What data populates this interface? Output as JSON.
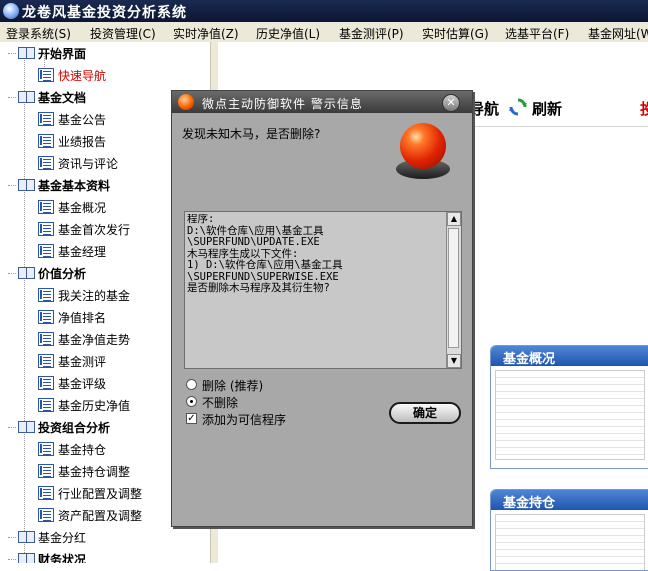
{
  "window": {
    "title": "龙卷风基金投资分析系统"
  },
  "menu": [
    "登录系统(S)",
    "投资管理(C)",
    "实时净值(Z)",
    "历史净值(L)",
    "基金测评(P)",
    "实时估算(G)",
    "选基平台(F)",
    "基金网址(W)"
  ],
  "sidebar": {
    "groups": [
      {
        "label": "开始界面",
        "items": [
          "快速导航"
        ]
      },
      {
        "label": "基金文档",
        "items": [
          "基金公告",
          "业绩报告",
          "资讯与评论"
        ]
      },
      {
        "label": "基金基本资料",
        "items": [
          "基金概况",
          "基金首次发行",
          "基金经理"
        ]
      },
      {
        "label": "价值分析",
        "items": [
          "我关注的基金",
          "净值排名",
          "基金净值走势",
          "基金测评",
          "基金评级",
          "基金历史净值"
        ]
      },
      {
        "label": "投资组合分析",
        "items": [
          "基金持仓",
          "基金持仓调整",
          "行业配置及调整",
          "资产配置及调整"
        ]
      },
      {
        "label": "基金分红",
        "items": []
      },
      {
        "label": "财务状况",
        "items": []
      }
    ],
    "active_item": "快速导航",
    "active_color": "#d60000"
  },
  "toolbar": {
    "nav_label_fragment": "导航",
    "refresh_label": "刷新",
    "right_fragment": "投"
  },
  "thumbnails": [
    {
      "title": "基金概况"
    },
    {
      "title": "基金持仓"
    }
  ],
  "dialog": {
    "title": "微点主动防御软件  警示信息",
    "question": "发现未知木马，是否删除?",
    "message": "程序:\nD:\\软件仓库\\应用\\基金工具\n\\SUPERFUND\\UPDATE.EXE\n木马程序生成以下文件:\n1) D:\\软件仓库\\应用\\基金工具\n\\SUPERFUND\\SUPERWISE.EXE\n是否删除木马程序及其衍生物?",
    "options": {
      "delete_label": "删除 (推荐)",
      "keep_label": "不删除",
      "trust_label": "添加为可信程序"
    },
    "selected_option": "不删除",
    "trust_checked": true,
    "ok_label": "确定"
  }
}
